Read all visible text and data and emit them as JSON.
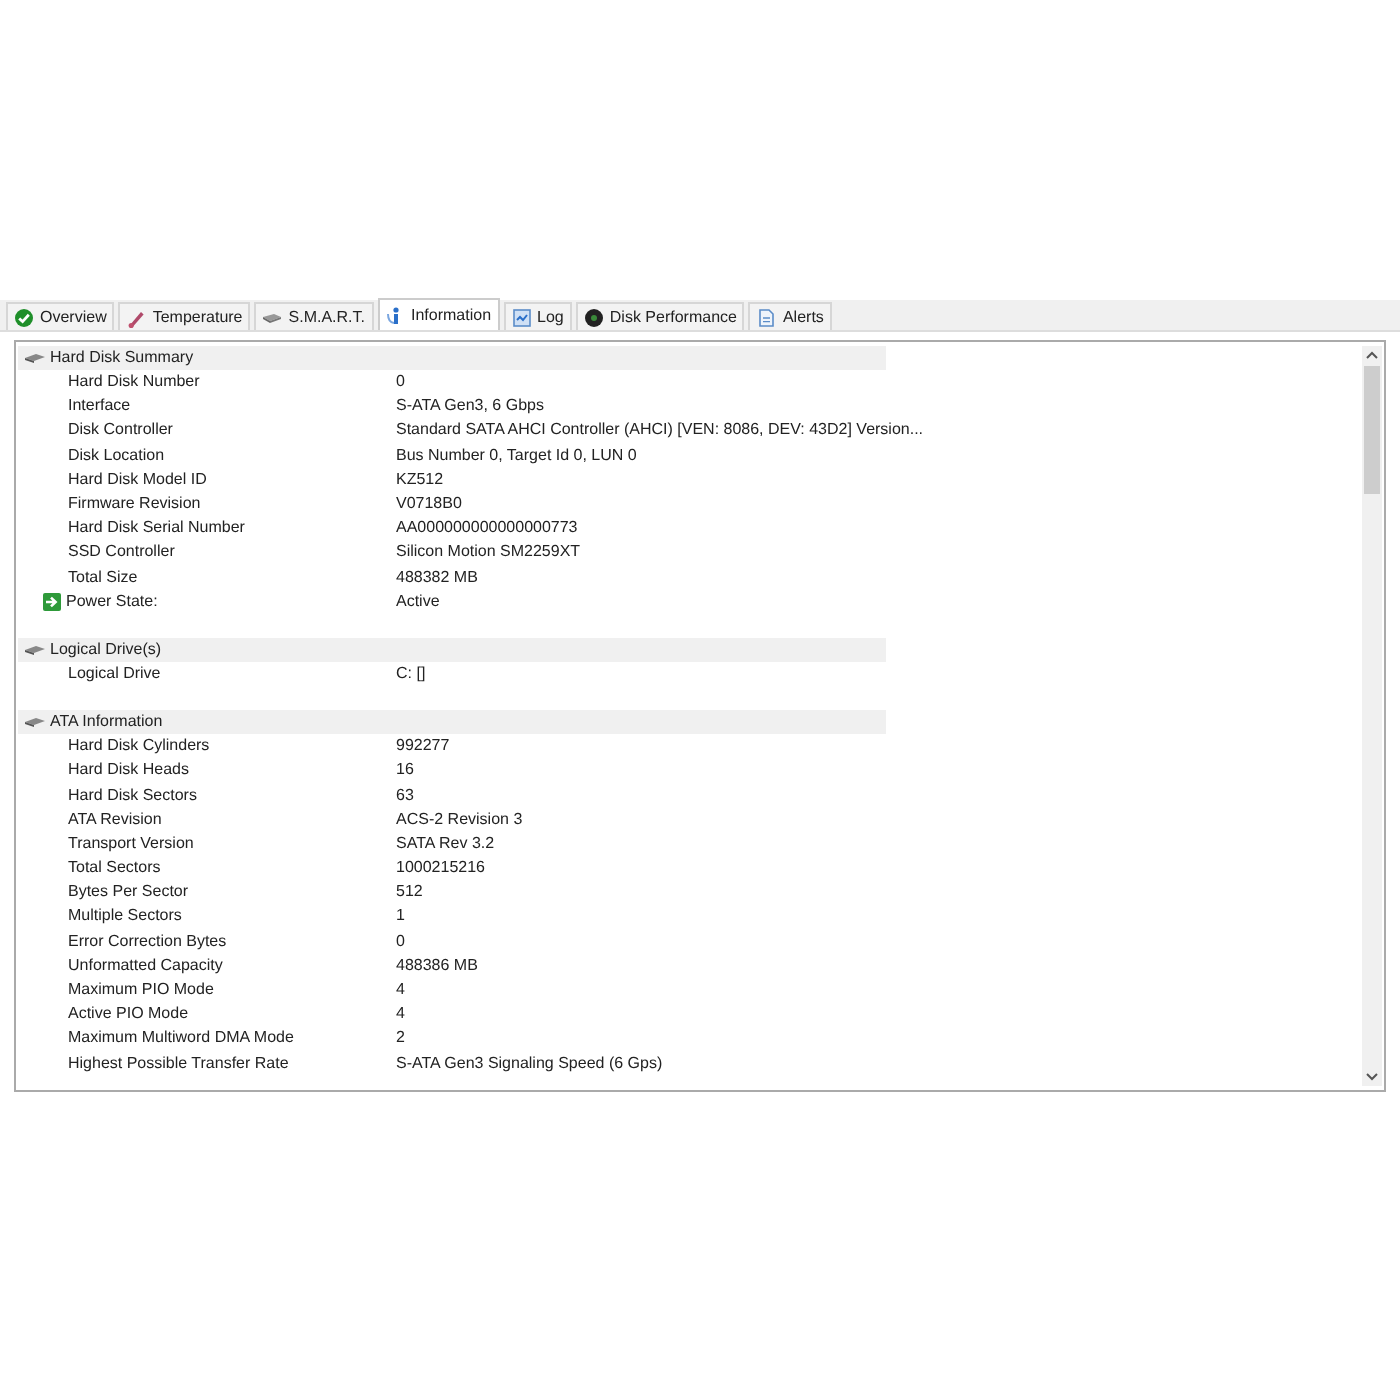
{
  "tabs": [
    {
      "label": "Overview",
      "selected": false
    },
    {
      "label": "Temperature",
      "selected": false
    },
    {
      "label": "S.M.A.R.T.",
      "selected": false
    },
    {
      "label": "Information",
      "selected": true
    },
    {
      "label": "Log",
      "selected": false
    },
    {
      "label": "Disk Performance",
      "selected": false
    },
    {
      "label": "Alerts",
      "selected": false
    }
  ],
  "sections": [
    {
      "title": "Hard Disk Summary",
      "rows": [
        {
          "label": "Hard Disk Number",
          "value": "0"
        },
        {
          "label": "Interface",
          "value": "S-ATA Gen3, 6 Gbps"
        },
        {
          "label": "Disk Controller",
          "value": "Standard SATA AHCI Controller (AHCI) [VEN: 8086, DEV: 43D2] Version..."
        },
        {
          "label": "Disk Location",
          "value": "Bus Number 0, Target Id 0, LUN 0"
        },
        {
          "label": "Hard Disk Model ID",
          "value": "KZ512"
        },
        {
          "label": "Firmware Revision",
          "value": "V0718B0"
        },
        {
          "label": "Hard Disk Serial Number",
          "value": "AA000000000000000773"
        },
        {
          "label": "SSD Controller",
          "value": "Silicon Motion SM2259XT"
        },
        {
          "label": "Total Size",
          "value": "488382 MB"
        },
        {
          "label": "Power State:",
          "value": "Active",
          "kind": "status"
        }
      ]
    },
    {
      "title": "Logical Drive(s)",
      "rows": [
        {
          "label": "Logical Drive",
          "value": "C: []"
        }
      ]
    },
    {
      "title": "ATA Information",
      "rows": [
        {
          "label": "Hard Disk Cylinders",
          "value": "992277"
        },
        {
          "label": "Hard Disk Heads",
          "value": "16"
        },
        {
          "label": "Hard Disk Sectors",
          "value": "63"
        },
        {
          "label": "ATA Revision",
          "value": "ACS-2 Revision 3"
        },
        {
          "label": "Transport Version",
          "value": "SATA Rev 3.2"
        },
        {
          "label": "Total Sectors",
          "value": "1000215216"
        },
        {
          "label": "Bytes Per Sector",
          "value": "512"
        },
        {
          "label": "Multiple Sectors",
          "value": "1"
        },
        {
          "label": "Error Correction Bytes",
          "value": "0"
        },
        {
          "label": "Unformatted Capacity",
          "value": "488386 MB"
        },
        {
          "label": "Maximum PIO Mode",
          "value": "4"
        },
        {
          "label": "Active PIO Mode",
          "value": "4"
        },
        {
          "label": "Maximum Multiword DMA Mode",
          "value": "2"
        },
        {
          "label": "Highest Possible Transfer Rate",
          "value": "S-ATA Gen3 Signaling Speed (6 Gps)"
        }
      ]
    }
  ]
}
